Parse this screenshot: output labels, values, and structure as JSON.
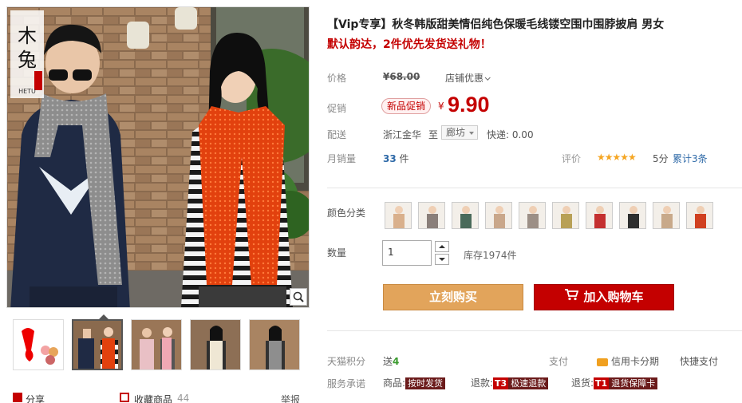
{
  "brand": {
    "logo_text": "木兔",
    "sub": "HETU"
  },
  "product": {
    "title": "【Vip专享】秋冬韩版甜美情侣纯色保暖毛线镂空围巾围脖披肩 男女",
    "subtitle": "默认韵达，2件优先发货送礼物！"
  },
  "price": {
    "label": "价格",
    "original": "¥68.00",
    "store_discount": "店铺优惠"
  },
  "promo": {
    "label": "促销",
    "tag": "新品促销",
    "yen": "¥",
    "price": "9.90"
  },
  "shipping": {
    "label": "配送",
    "origin": "浙江金华",
    "to": "至",
    "destination": "廊坊",
    "express": "快递: 0.00"
  },
  "sales": {
    "label": "月销量",
    "count": "33",
    "unit": "件",
    "rating_label": "评价",
    "stars": "★★★★★",
    "score": "5分",
    "reviews": "累计3条"
  },
  "colors": {
    "label": "颜色分类",
    "swatches": [
      "#d9b08c",
      "#8a7f7a",
      "#4a6a5a",
      "#c9a78b",
      "#9c8f86",
      "#b8a056",
      "#c43030",
      "#2e2e2e",
      "#c8a98a",
      "#d04020"
    ]
  },
  "quantity": {
    "label": "数量",
    "value": "1",
    "stock": "库存1974件"
  },
  "buttons": {
    "buy": "立刻购买",
    "cart": "加入购物车"
  },
  "points": {
    "label": "天猫积分",
    "send": "送",
    "value": "4",
    "pay_label": "支付",
    "credit": "信用卡分期",
    "quick": "快捷支付"
  },
  "service": {
    "label": "服务承诺",
    "goods": "商品:",
    "goods_tag": "按时发货",
    "refund": "退款:",
    "refund_t": "T3",
    "refund_tag": "极速退款",
    "return": "退货:",
    "return_t": "T1",
    "return_tag": "退货保障卡"
  },
  "bottom": {
    "share": "分享",
    "collect": "收藏商品",
    "collect_count": "44",
    "report": "举报"
  }
}
